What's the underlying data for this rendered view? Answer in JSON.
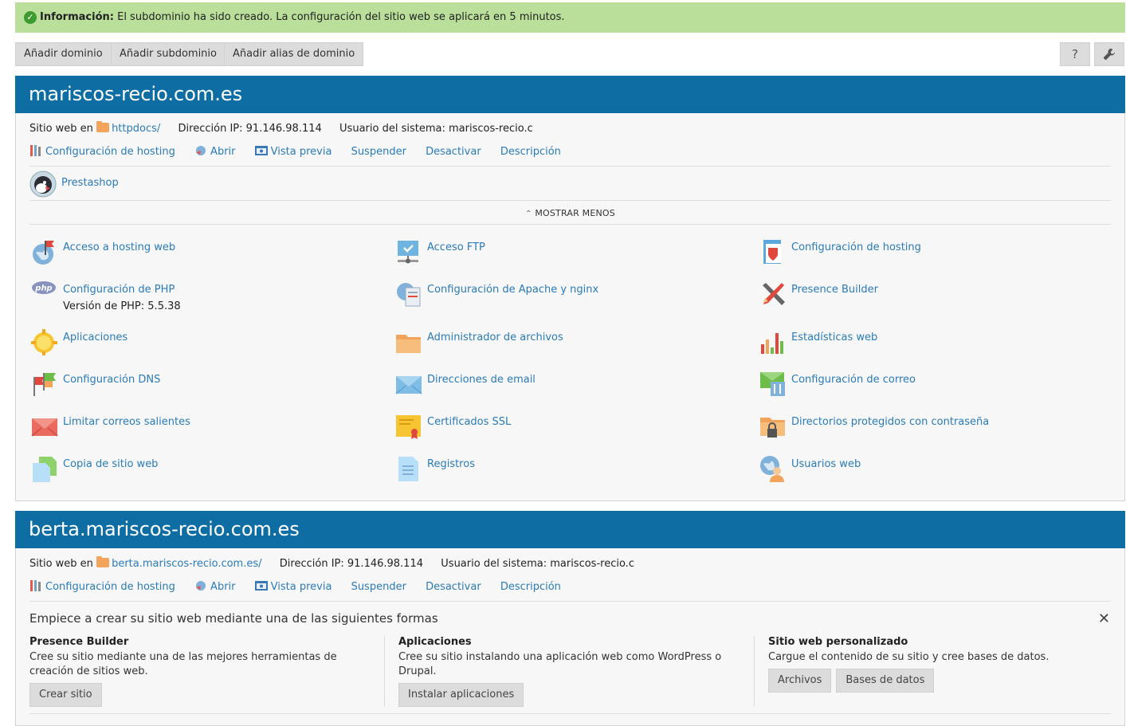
{
  "notice": {
    "label": "Información:",
    "text": " El subdominio ha sido creado. La configuración del sitio web se aplicará en 5 minutos."
  },
  "toolbar": {
    "add_domain": "Añadir dominio",
    "add_subdomain": "Añadir subdominio",
    "add_alias": "Añadir alias de dominio",
    "help": "?",
    "tools_icon": "wrench-icon"
  },
  "site1": {
    "title": "mariscos-recio.com.es",
    "site_at": "Sitio web en",
    "doc_root": "httpdocs/",
    "ip_label": "Dirección IP:",
    "ip": "91.146.98.114",
    "user_label": "Usuario del sistema:",
    "user": "mariscos-recio.c",
    "actions": [
      "Configuración de hosting",
      "Abrir",
      "Vista previa",
      "Suspender",
      "Desactivar",
      "Descripción"
    ],
    "app": "Prestashop",
    "toggle": "MOSTRAR MENOS",
    "tools": [
      "Acceso a hosting web",
      "Acceso FTP",
      "Configuración de hosting",
      "Configuración de PHP",
      "Configuración de Apache y nginx",
      "Presence Builder",
      "Aplicaciones",
      "Administrador de archivos",
      "Estadísticas web",
      "Configuración DNS",
      "Direcciones de email",
      "Configuración de correo",
      "Limitar correos salientes",
      "Certificados SSL",
      "Directorios protegidos con contraseña",
      "Copia de sitio web",
      "Registros",
      "Usuarios web"
    ],
    "php_version": "Versión de PHP: 5.5.38"
  },
  "site2": {
    "title": "berta.mariscos-recio.com.es",
    "site_at": "Sitio web en",
    "doc_root": "berta.mariscos-recio.com.es/",
    "ip_label": "Dirección IP:",
    "ip": "91.146.98.114",
    "user_label": "Usuario del sistema:",
    "user": "mariscos-recio.c",
    "actions": [
      "Configuración de hosting",
      "Abrir",
      "Vista previa",
      "Suspender",
      "Desactivar",
      "Descripción"
    ],
    "start_title": "Empiece a crear su sitio web mediante una de las siguientes formas",
    "close": "✕",
    "options": [
      {
        "title": "Presence Builder",
        "desc": "Cree su sitio mediante una de las mejores herramientas de creación de sitios web.",
        "buttons": [
          "Crear sitio"
        ]
      },
      {
        "title": "Aplicaciones",
        "desc": "Cree su sitio instalando una aplicación web como WordPress o Drupal.",
        "buttons": [
          "Instalar aplicaciones"
        ]
      },
      {
        "title": "Sitio web personalizado",
        "desc": "Cargue el contenido de su sitio y cree bases de datos.",
        "buttons": [
          "Archivos",
          "Bases de datos"
        ]
      }
    ]
  }
}
